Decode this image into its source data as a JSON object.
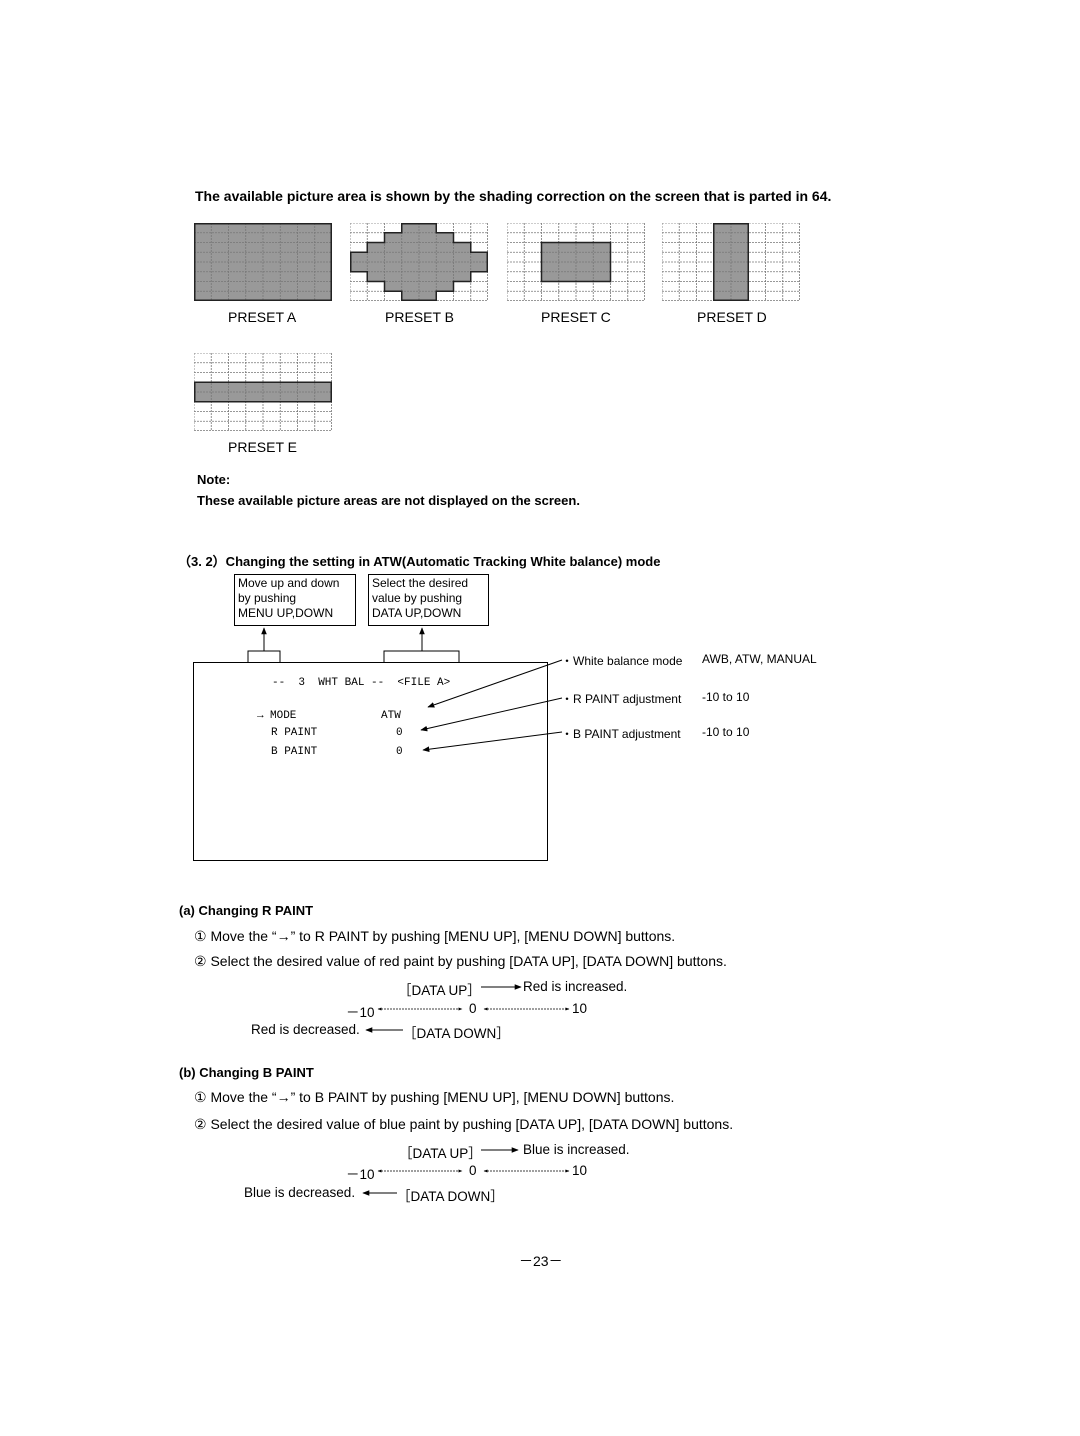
{
  "intro_text": "The available picture area is shown by the shading correction on the screen that is parted in 64.",
  "presets": [
    {
      "label": "PRESET A",
      "grid_cols": 8,
      "grid_rows": 8,
      "shaded_cells_by_row": [
        [
          0,
          7
        ],
        [
          0,
          7
        ],
        [
          0,
          7
        ],
        [
          0,
          7
        ],
        [
          0,
          7
        ],
        [
          0,
          7
        ],
        [
          0,
          7
        ],
        [
          0,
          7
        ]
      ]
    },
    {
      "label": "PRESET B",
      "grid_cols": 8,
      "grid_rows": 8,
      "shaded_cells_by_row": [
        [
          3,
          4
        ],
        [
          2,
          5
        ],
        [
          1,
          6
        ],
        [
          0,
          7
        ],
        [
          0,
          7
        ],
        [
          1,
          6
        ],
        [
          2,
          5
        ],
        [
          3,
          4
        ]
      ]
    },
    {
      "label": "PRESET C",
      "grid_cols": 8,
      "grid_rows": 8,
      "shaded_cells_by_row": [
        null,
        null,
        [
          2,
          5
        ],
        [
          2,
          5
        ],
        [
          2,
          5
        ],
        [
          2,
          5
        ],
        null,
        null
      ]
    },
    {
      "label": "PRESET D",
      "grid_cols": 8,
      "grid_rows": 8,
      "shaded_cells_by_row": [
        [
          3,
          4
        ],
        [
          3,
          4
        ],
        [
          3,
          4
        ],
        [
          3,
          4
        ],
        [
          3,
          4
        ],
        [
          3,
          4
        ],
        [
          3,
          4
        ],
        [
          3,
          4
        ]
      ]
    },
    {
      "label": "PRESET E",
      "grid_cols": 8,
      "grid_rows": 8,
      "shaded_cells_by_row": [
        null,
        null,
        null,
        [
          0,
          7
        ],
        [
          0,
          7
        ],
        null,
        null,
        null
      ]
    }
  ],
  "colors": {
    "shade": "#999999",
    "grid_line": "#777777",
    "text": "#000000"
  },
  "note": {
    "title": "Note:",
    "text": "These available picture areas are not displayed on the screen."
  },
  "section": {
    "title": "（3. 2）Changing the setting in ATW(Automatic Tracking White balance) mode"
  },
  "callouts": {
    "menu": [
      "Move up and down",
      "by pushing",
      "MENU UP,DOWN"
    ],
    "data": [
      "Select the desired",
      "value by pushing",
      "DATA UP,DOWN"
    ]
  },
  "osd": {
    "header": "--  3  WHT BAL --  <FILE A>",
    "rows": [
      {
        "cursor": "→",
        "label": "MODE",
        "value": "ATW"
      },
      {
        "cursor": "",
        "label": "R PAINT",
        "value": "0"
      },
      {
        "cursor": "",
        "label": "B PAINT",
        "value": "0"
      }
    ]
  },
  "legend": [
    {
      "bullet": "・",
      "item": "White balance mode",
      "range": "AWB, ATW, MANUAL"
    },
    {
      "bullet": "・",
      "item": "R PAINT adjustment",
      "range": "-10 to 10"
    },
    {
      "bullet": "・",
      "item": "B PAINT adjustment",
      "range": "-10 to 10"
    }
  ],
  "sub_a": {
    "title": "(a) Changing R PAINT",
    "step1": "① Move the “→” to R PAINT by pushing [MENU UP], [MENU DOWN] buttons.",
    "step2": "② Select the desired value of red paint by pushing [DATA UP], [DATA DOWN] buttons.",
    "data_up": "［DATA UP］",
    "increased": "Red is increased.",
    "min": "－10",
    "mid": "0",
    "max": "10",
    "decreased": "Red is decreased.",
    "data_down": "［DATA DOWN］"
  },
  "sub_b": {
    "title": "(b) Changing B PAINT",
    "step1": "① Move the “→” to B PAINT by pushing [MENU UP], [MENU DOWN] buttons.",
    "step2": "② Select the desired value of blue paint by pushing [DATA UP], [DATA DOWN] buttons.",
    "data_up": "［DATA UP］",
    "increased": "Blue is increased.",
    "min": "－10",
    "mid": "0",
    "max": "10",
    "decreased": "Blue is decreased.",
    "data_down": "［DATA DOWN］"
  },
  "page_number": "－23－"
}
